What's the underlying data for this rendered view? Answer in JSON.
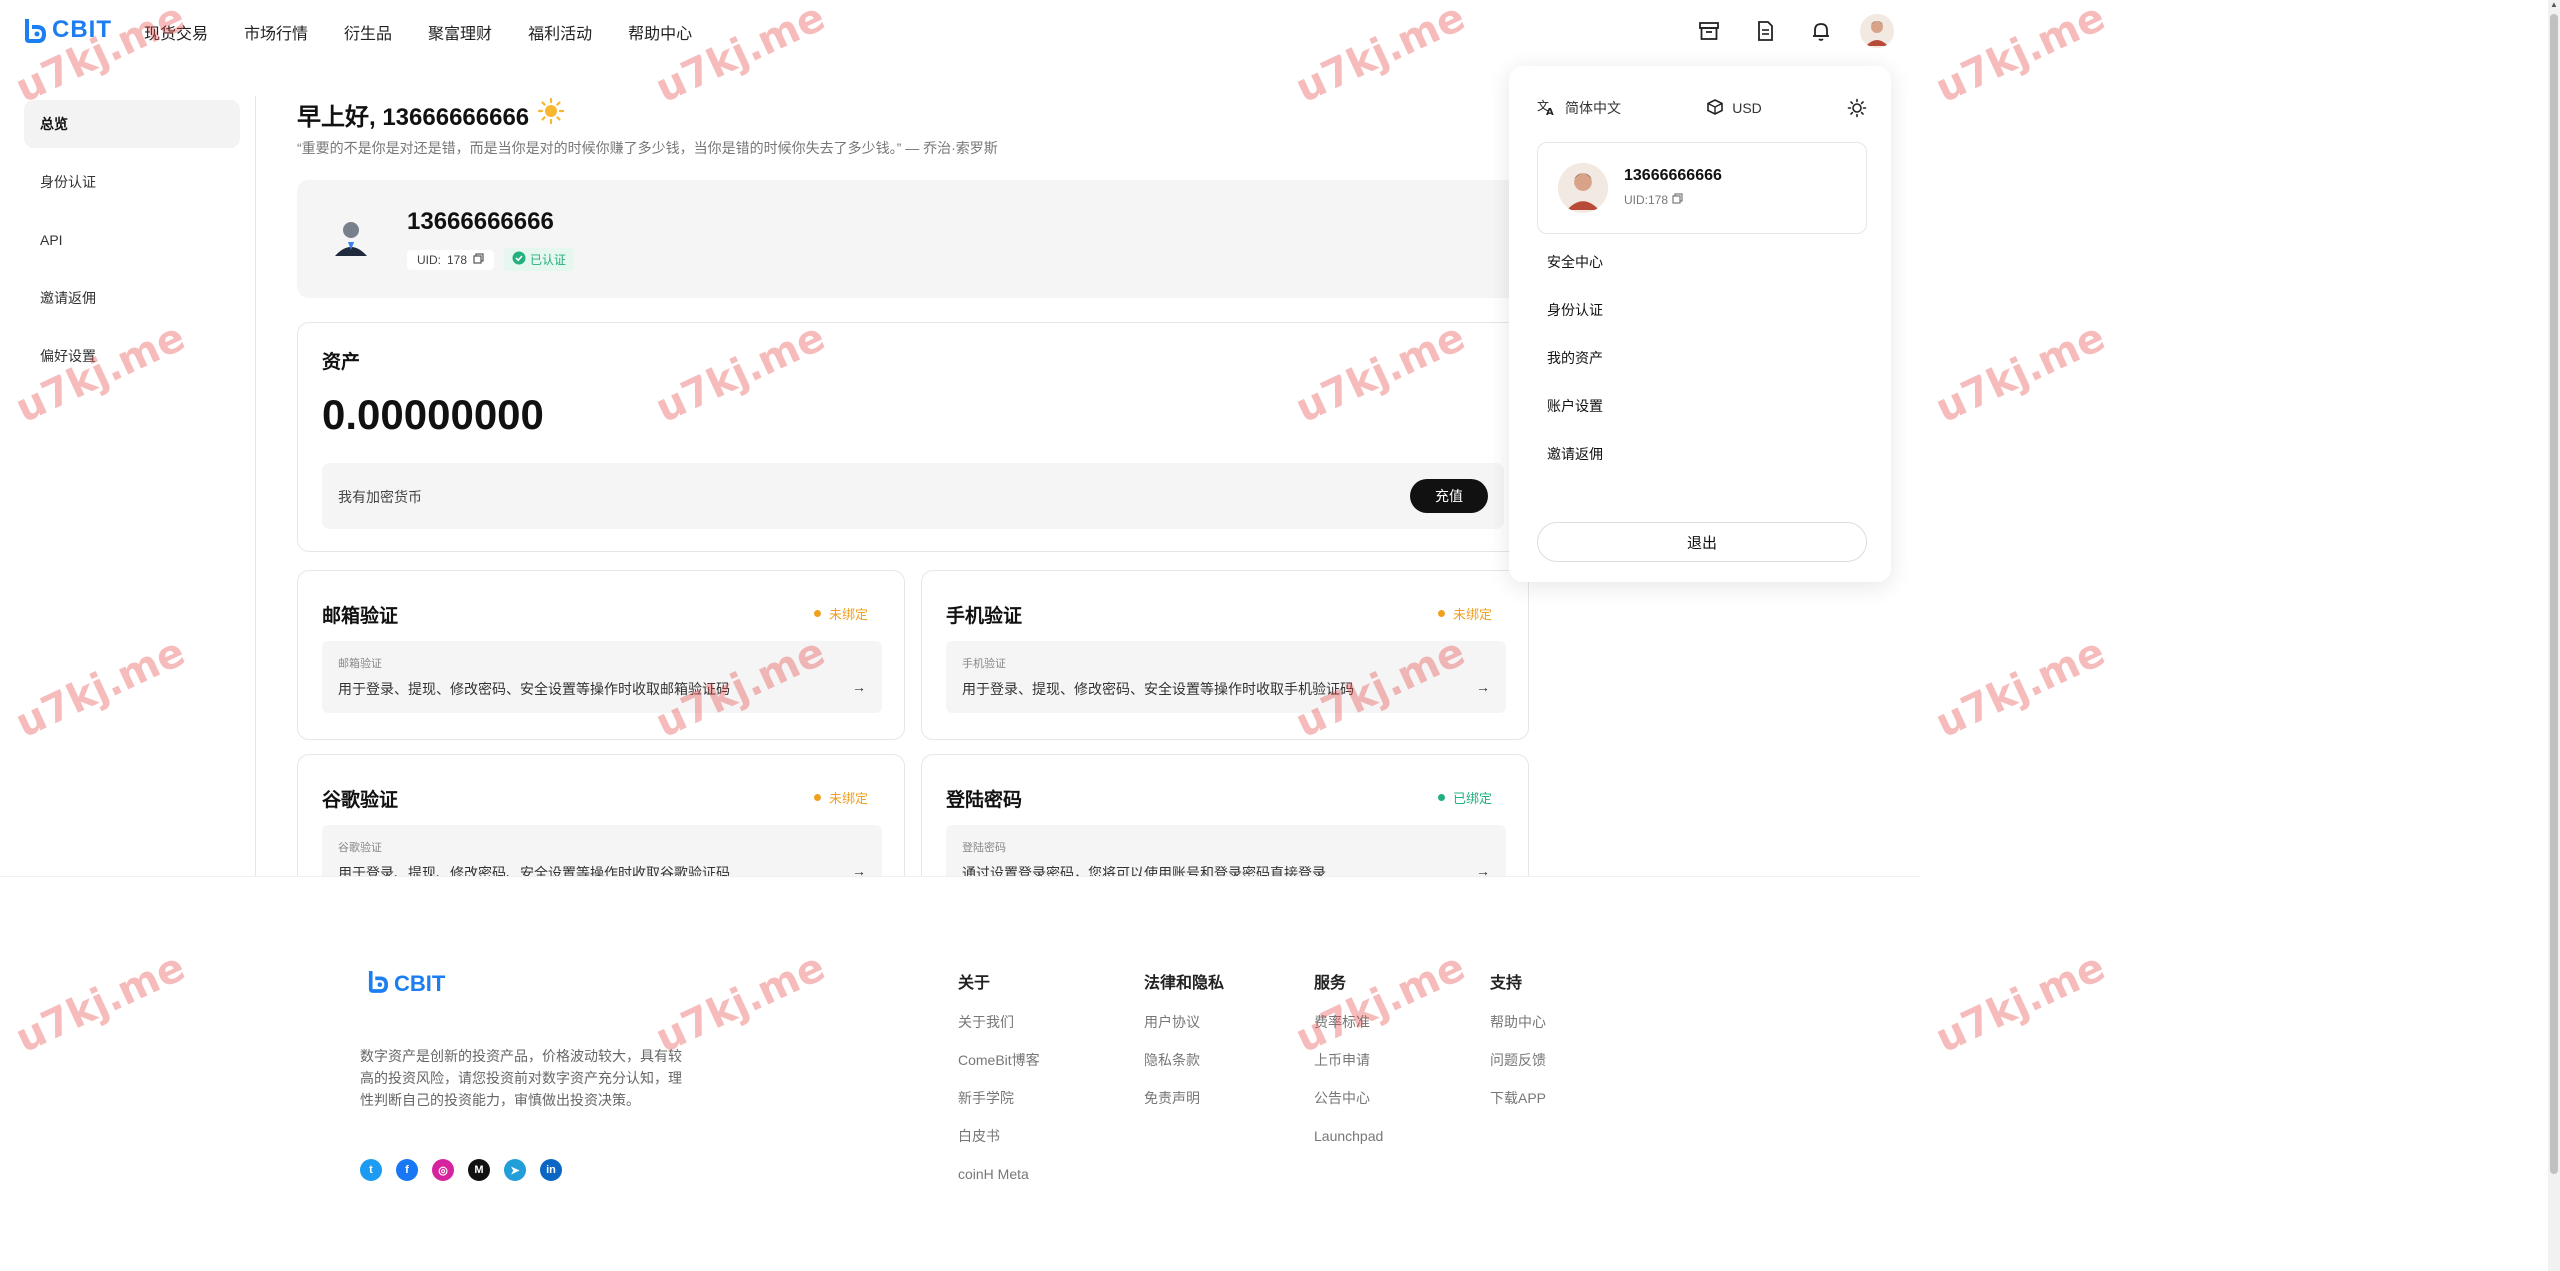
{
  "header": {
    "logo_text": "CBIT",
    "nav": [
      "现货交易",
      "市场行情",
      "衍生品",
      "聚富理财",
      "福利活动",
      "帮助中心"
    ]
  },
  "sidebar": {
    "items": [
      {
        "label": "总览",
        "active": true
      },
      {
        "label": "身份认证"
      },
      {
        "label": "API"
      },
      {
        "label": "邀请返佣"
      },
      {
        "label": "偏好设置"
      }
    ]
  },
  "greeting": {
    "text": "早上好, 13666666666",
    "quote": "“重要的不是你是对还是错，而是当你是对的时候你赚了多少钱，当你是错的时候你失去了多少钱。” — 乔治·索罗斯"
  },
  "profile": {
    "name": "13666666666",
    "uid_label": "UID:",
    "uid_value": "178",
    "verified": "已认证"
  },
  "assets": {
    "title": "资产",
    "value": "0.00000000",
    "row_label": "我有加密货币",
    "deposit": "充值"
  },
  "security": [
    {
      "title": "邮箱验证",
      "status": "未绑定",
      "status_color": "#f0a020",
      "sub": "邮箱验证",
      "desc": "用于登录、提现、修改密码、安全设置等操作时收取邮箱验证码"
    },
    {
      "title": "手机验证",
      "status": "未绑定",
      "status_color": "#f0a020",
      "sub": "手机验证",
      "desc": "用于登录、提现、修改密码、安全设置等操作时收取手机验证码"
    },
    {
      "title": "谷歌验证",
      "status": "未绑定",
      "status_color": "#f0a020",
      "sub": "谷歌验证",
      "desc": "用于登录、提现、修改密码、安全设置等操作时收取谷歌验证码"
    },
    {
      "title": "登陆密码",
      "status": "已绑定",
      "status_color": "#22b07d",
      "sub": "登陆密码",
      "desc": "通过设置登录密码，您将可以使用账号和登录密码直接登录"
    }
  ],
  "dropdown": {
    "language": "简体中文",
    "currency": "USD",
    "user_name": "13666666666",
    "user_uid": "UID:178",
    "items": [
      "安全中心",
      "身份认证",
      "我的资产",
      "账户设置",
      "邀请返佣"
    ],
    "logout": "退出"
  },
  "footer": {
    "logo_text": "CBIT",
    "desc": "数字资产是创新的投资产品，价格波动较大，具有较高的投资风险，请您投资前对数字资产充分认知，理性判断自己的投资能力，审慎做出投资决策。",
    "columns": [
      {
        "title": "关于",
        "links": [
          "关于我们",
          "ComeBit博客",
          "新手学院",
          "白皮书",
          "coinH Meta"
        ]
      },
      {
        "title": "法律和隐私",
        "links": [
          "用户协议",
          "隐私条款",
          "免责声明"
        ]
      },
      {
        "title": "服务",
        "links": [
          "费率标准",
          "上币申请",
          "公告中心",
          "Launchpad"
        ]
      },
      {
        "title": "支持",
        "links": [
          "帮助中心",
          "问题反馈",
          "下载APP"
        ]
      }
    ],
    "social": [
      "twitter-icon",
      "facebook-icon",
      "instagram-icon",
      "medium-icon",
      "telegram-icon",
      "linkedin-icon"
    ]
  },
  "watermark": "u7kj.me",
  "colors": {
    "brand": "#1c7ef0",
    "success": "#22b07d",
    "warning": "#f0a020"
  }
}
